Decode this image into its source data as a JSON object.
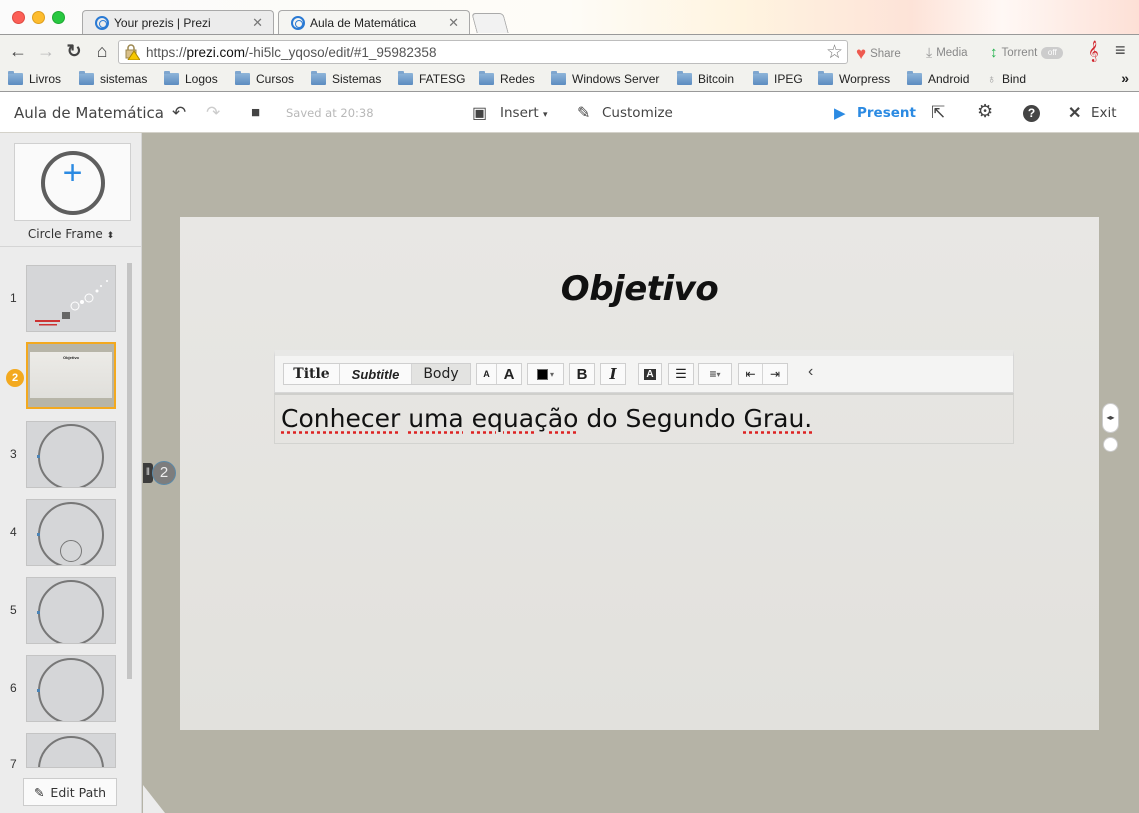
{
  "browser": {
    "tabs": [
      {
        "title": "Your prezis | Prezi",
        "active": false
      },
      {
        "title": "Aula de Matemática",
        "active": true
      }
    ],
    "url_prefix": "https://",
    "url_domain": "prezi.com",
    "url_path": "/-hi5lc_yqoso/edit/#1_95982358",
    "extensions": {
      "share": "Share",
      "media": "Media",
      "torrent": "Torrent",
      "torrent_state": "off"
    },
    "bookmarks": [
      "Livros",
      "sistemas",
      "Logos",
      "Cursos",
      "Sistemas",
      "FATESG",
      "Redes",
      "Windows Server",
      "Bitcoin",
      "IPEG",
      "Worpress",
      "Android",
      "Bind"
    ],
    "bookmarks_more": "»"
  },
  "toolbar": {
    "doc_title": "Aula de Matemática",
    "saved_status": "Saved at 20:38",
    "insert_label": "Insert",
    "customize_label": "Customize",
    "present_label": "Present",
    "exit_label": "Exit"
  },
  "sidebar": {
    "frame_type": "Circle Frame",
    "thumbnails": [
      {
        "number": "1",
        "type": "title"
      },
      {
        "number": "2",
        "type": "selected",
        "mini_title": "Objetivo"
      },
      {
        "number": "3",
        "type": "circle"
      },
      {
        "number": "4",
        "type": "circle"
      },
      {
        "number": "5",
        "type": "circle"
      },
      {
        "number": "6",
        "type": "circle"
      },
      {
        "number": "7",
        "type": "circle"
      }
    ],
    "current_step": "2",
    "edit_path_label": "Edit Path"
  },
  "canvas": {
    "path_step": "2",
    "slide_title": "Objetivo",
    "body_text_words": [
      "Conhecer",
      "uma",
      "equação",
      "do",
      "Segundo",
      "Grau."
    ],
    "format_toolbar": {
      "styles": [
        "Title",
        "Subtitle",
        "Body"
      ],
      "active_style": "Body",
      "bold": "B",
      "italic": "I",
      "font_small": "A",
      "font_large": "A",
      "highlight": "A",
      "collapse": "‹"
    }
  },
  "colors": {
    "accent_blue": "#2b8ae2",
    "selected_orange": "#f3a91f",
    "canvas_bg": "#b5b3a6"
  }
}
